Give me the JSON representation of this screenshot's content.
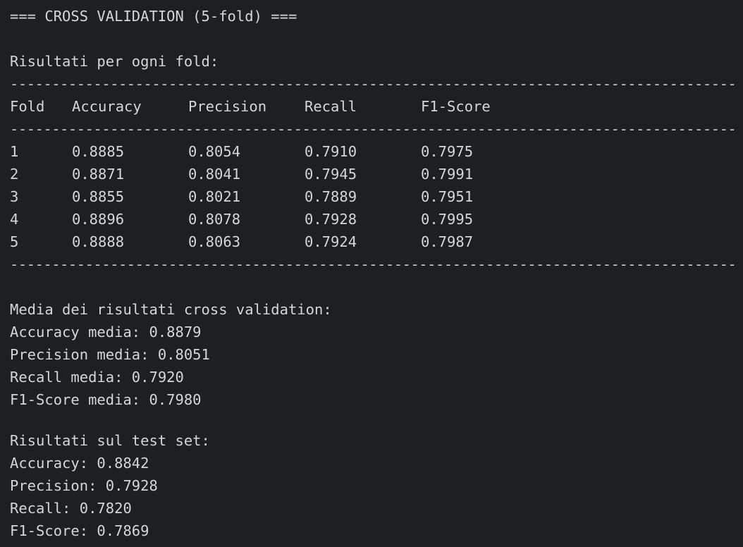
{
  "console": {
    "title": "=== CROSS VALIDATION (5-fold) ===",
    "per_fold_heading": "Risultati per ogni fold:",
    "separator": "------------------------------------------------------------------------------------------",
    "table": {
      "headers": [
        "Fold",
        "Accuracy",
        "Precision",
        "Recall",
        "F1-Score"
      ],
      "rows": [
        [
          "1",
          "0.8885",
          "0.8054",
          "0.7910",
          "0.7975"
        ],
        [
          "2",
          "0.8871",
          "0.8041",
          "0.7945",
          "0.7991"
        ],
        [
          "3",
          "0.8855",
          "0.8021",
          "0.7889",
          "0.7951"
        ],
        [
          "4",
          "0.8896",
          "0.8078",
          "0.7928",
          "0.7995"
        ],
        [
          "5",
          "0.8888",
          "0.8063",
          "0.7924",
          "0.7987"
        ]
      ]
    },
    "cv_summary": {
      "heading": "Media dei risultati cross validation:",
      "accuracy": "Accuracy media: 0.8879",
      "precision": "Precision media: 0.8051",
      "recall": "Recall media: 0.7920",
      "f1": "F1-Score media: 0.7980"
    },
    "test_results": {
      "heading": "Risultati sul test set:",
      "accuracy": "Accuracy: 0.8842",
      "precision": "Precision: 0.7928",
      "recall": "Recall: 0.7820",
      "f1": "F1-Score: 0.7869"
    }
  }
}
